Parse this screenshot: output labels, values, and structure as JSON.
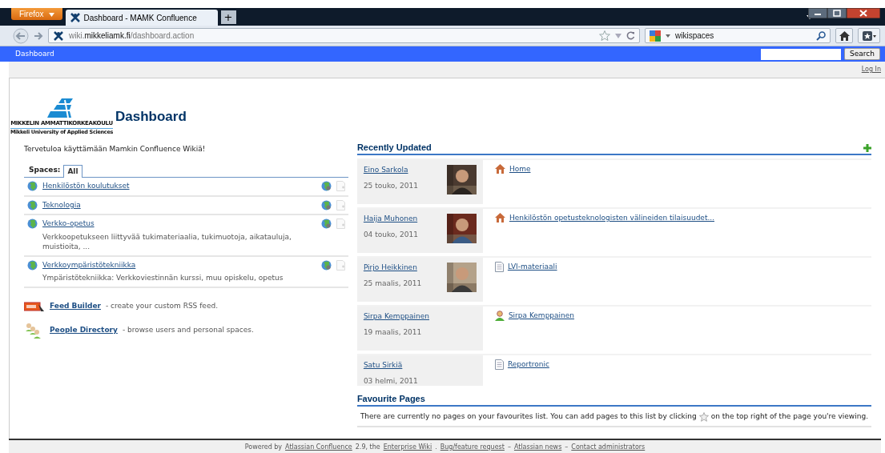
{
  "browser": {
    "menu_button": "Firefox",
    "tabs": [
      {
        "label": "Dashboard - MAMK Confluence",
        "selected": true
      }
    ],
    "new_tab": "+",
    "url": "wiki.**mikkeliamk.fi**/dashboard.action",
    "search_query": "wikispaces"
  },
  "topbar": {
    "breadcrumb": "Dashboard",
    "search_button": "Search",
    "login": "Log In"
  },
  "header": {
    "logo_name": "MIKKELIN AMMATTIKORKEAKOULU",
    "logo_subtitle": "Mikkeli University of Applied Sciences",
    "title": "Dashboard"
  },
  "welcome": "Tervetuloa käyttämään Mamkin Confluence Wikiä!",
  "spaces": {
    "label": "Spaces:",
    "tabs": [
      {
        "label": "All",
        "selected": true
      }
    ],
    "items": [
      {
        "name": "Henkilöstön koulutukset"
      },
      {
        "name": "Teknologia"
      },
      {
        "name": "Verkko-opetus",
        "description": "Verkkoopetukseen liittyvää tukimateriaalia, tukimuotoja, aikatauluja, muistioita, ..."
      },
      {
        "name": "Verkkoympäristötekniikka",
        "description": "Ympäristötekniikka: Verkkoviestinnän kurssi, muu opiskelu, opetus"
      }
    ]
  },
  "links": [
    {
      "kind": "rss",
      "title": "Feed Builder",
      "description": "- create your custom RSS feed."
    },
    {
      "kind": "people",
      "title": "People Directory",
      "description": "- browse users and personal spaces."
    }
  ],
  "recent": {
    "title": "Recently Updated",
    "items": [
      {
        "user": "Eino Sarkola",
        "date": "25 touko, 2011",
        "photo": true,
        "page": "Home",
        "kind": "home"
      },
      {
        "user": "Haija Muhonen",
        "date": "04 touko, 2011",
        "photo": true,
        "page": "Henkilöstön opetusteknologisten välineiden tilaisuudet...",
        "kind": "home"
      },
      {
        "user": "Pirjo Heikkinen",
        "date": "25 maalis, 2011",
        "photo": true,
        "page": "LVI-materiaali",
        "kind": "page"
      },
      {
        "user": "Sirpa Kemppainen",
        "date": "19 maalis, 2011",
        "photo": false,
        "page": "Sirpa Kemppainen",
        "kind": "profile"
      },
      {
        "user": "Satu Sirkiä",
        "date": "03 helmi, 2011",
        "photo": false,
        "page": "Reportronic",
        "kind": "page"
      }
    ]
  },
  "favourites": {
    "title": "Favourite Pages",
    "text_before": "There are currently no pages on your favourites list. You can add pages to this list by clicking",
    "text_after": "on the top right of the page you're viewing."
  },
  "footer": [
    {
      "kind": "text",
      "text": "Powered by"
    },
    {
      "kind": "link",
      "text": "Atlassian Confluence"
    },
    {
      "kind": "text",
      "text": "2.9, the"
    },
    {
      "kind": "link",
      "text": "Enterprise Wiki"
    },
    {
      "kind": "text",
      "text": "."
    },
    {
      "kind": "link",
      "text": "Bug/feature request"
    },
    {
      "kind": "text",
      "text": "–"
    },
    {
      "kind": "link",
      "text": "Atlassian news"
    },
    {
      "kind": "text",
      "text": "–"
    },
    {
      "kind": "link",
      "text": "Contact administrators"
    }
  ]
}
